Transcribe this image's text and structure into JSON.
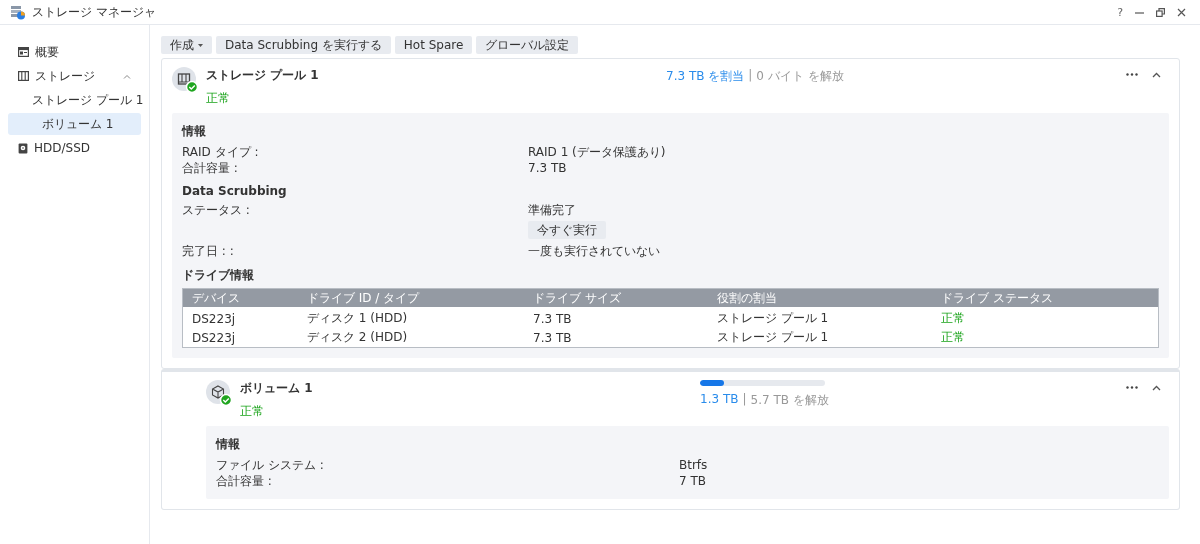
{
  "window": {
    "title": "ストレージ マネージャ",
    "help": "?"
  },
  "sidebar": {
    "items": [
      {
        "label": "概要",
        "selected": false
      },
      {
        "label": "ストレージ",
        "selected": false,
        "expanded": true,
        "children": [
          {
            "label": "ストレージ プール 1",
            "selected": false,
            "children": [
              {
                "label": "ボリューム 1",
                "selected": true
              }
            ]
          }
        ]
      },
      {
        "label": "HDD/SSD",
        "selected": false
      }
    ]
  },
  "toolbar": [
    {
      "label": "作成",
      "dropdown": true
    },
    {
      "label": "Data Scrubbing を実行する",
      "dropdown": false
    },
    {
      "label": "Hot Spare",
      "dropdown": false
    },
    {
      "label": "グローバル設定",
      "dropdown": false
    }
  ],
  "pool": {
    "title": "ストレージ プール 1",
    "status": "正常",
    "used": "7.3 TB を割当",
    "separator": "|",
    "free": "0 バイト を解放",
    "expanded": true,
    "sections": [
      {
        "title": "情報",
        "rows": [
          {
            "label": "RAID タイプ :",
            "value": "RAID 1 (データ保護あり)"
          },
          {
            "label": "合計容量 :",
            "value": "7.3 TB"
          }
        ]
      },
      {
        "title": "Data Scrubbing",
        "rows": [
          {
            "label": "ステータス :",
            "value": "準備完了",
            "button": "今すぐ実行"
          },
          {
            "label": "完了日 : :",
            "value": "一度も実行されていない"
          }
        ]
      }
    ],
    "drives": {
      "title": "ドライブ情報",
      "columns": [
        {
          "label": "デバイス",
          "kind": "text"
        },
        {
          "label": "ドライブ ID / タイプ",
          "kind": "text"
        },
        {
          "label": "ドライブ サイズ",
          "kind": "text"
        },
        {
          "label": "役割の割当",
          "kind": "text"
        },
        {
          "label": "ドライブ ステータス",
          "kind": "status"
        }
      ],
      "rows": [
        [
          "DS223j",
          "ディスク 1 (HDD)",
          "7.3 TB",
          "ストレージ プール 1",
          "正常"
        ],
        [
          "DS223j",
          "ディスク 2 (HDD)",
          "7.3 TB",
          "ストレージ プール 1",
          "正常"
        ]
      ]
    }
  },
  "volume": {
    "title": "ボリューム 1",
    "status": "正常",
    "level": 0.19,
    "used": "1.3 TB",
    "separator": "|",
    "free": "5.7 TB を解放",
    "expanded": true,
    "sections": [
      {
        "title": "情報",
        "rows": [
          {
            "label": "ファイル システム :",
            "value": "Btrfs"
          },
          {
            "label": "合計容量 :",
            "value": "7 TB"
          }
        ]
      }
    ]
  }
}
